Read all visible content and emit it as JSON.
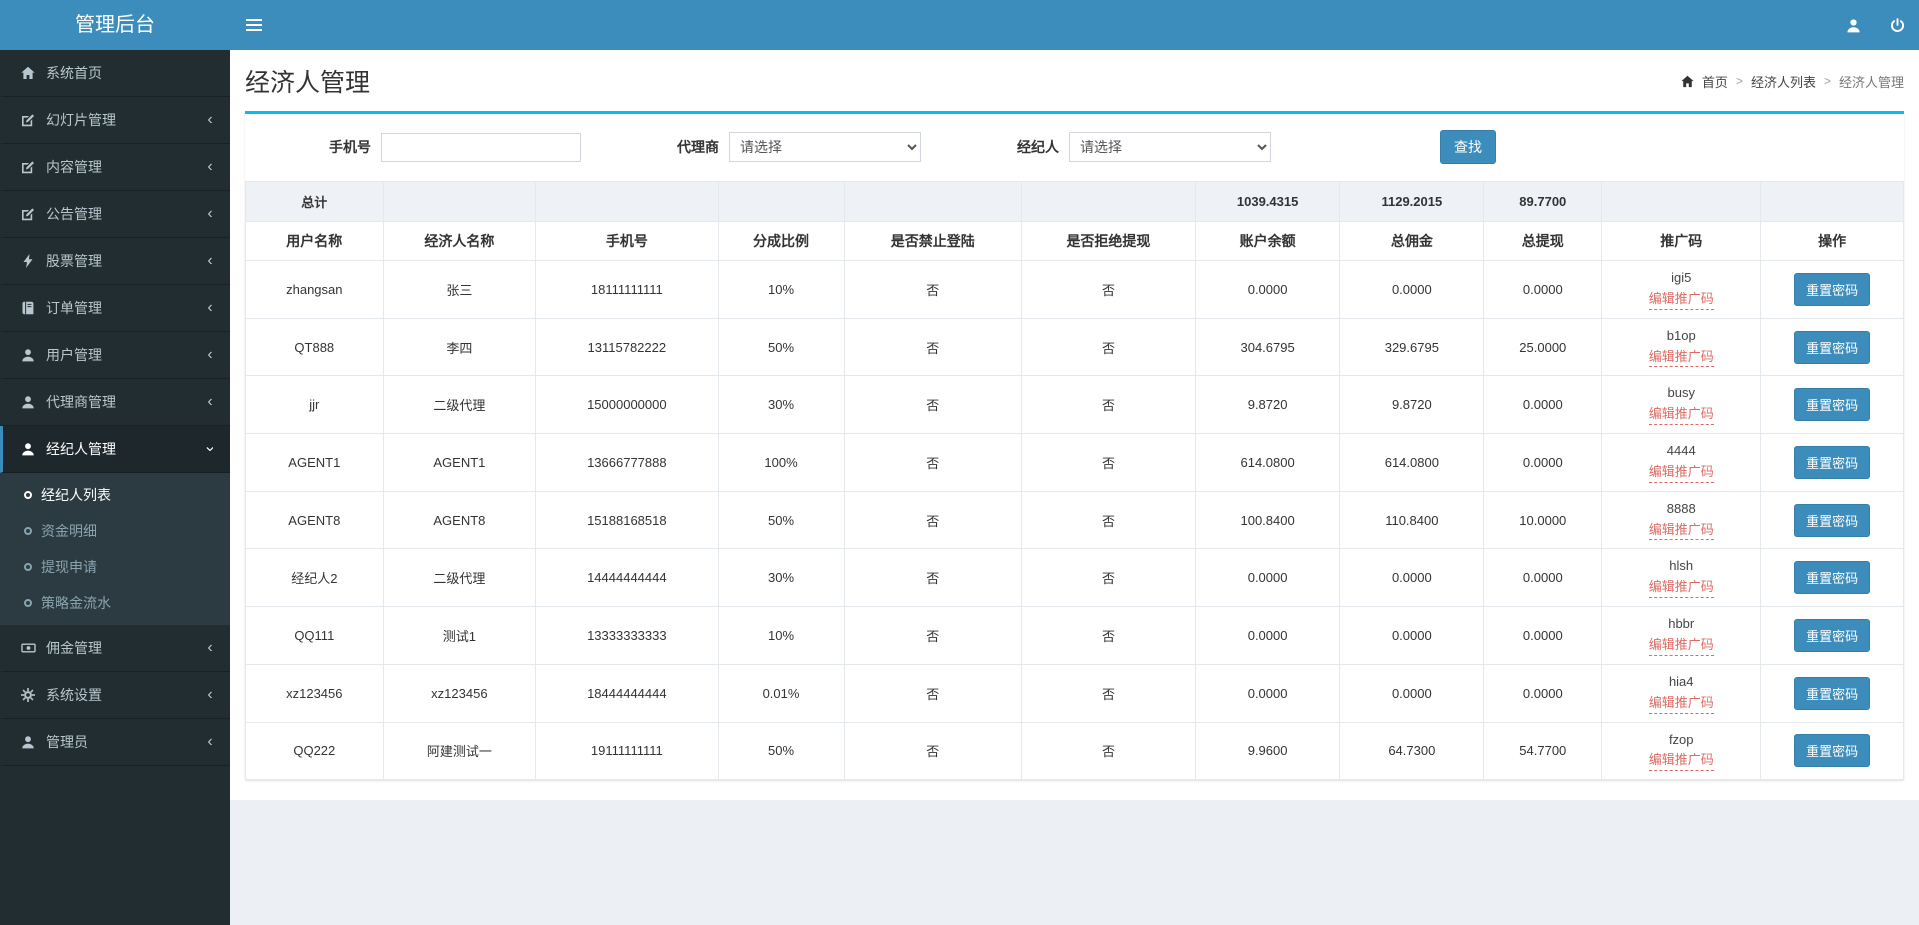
{
  "app": {
    "title": "管理后台"
  },
  "navbar": {
    "icons": [
      "bars-icon",
      "user-icon",
      "power-icon"
    ]
  },
  "sidebar": {
    "items": [
      {
        "label": "系统首页",
        "icon": "home-icon"
      },
      {
        "label": "幻灯片管理",
        "icon": "edit-icon",
        "chevron": "‹"
      },
      {
        "label": "内容管理",
        "icon": "edit-icon",
        "chevron": "‹"
      },
      {
        "label": "公告管理",
        "icon": "edit-icon",
        "chevron": "‹"
      },
      {
        "label": "股票管理",
        "icon": "bolt-icon",
        "chevron": "‹"
      },
      {
        "label": "订单管理",
        "icon": "book-icon",
        "chevron": "‹"
      },
      {
        "label": "用户管理",
        "icon": "user-icon",
        "chevron": "‹"
      },
      {
        "label": "代理商管理",
        "icon": "user-icon",
        "chevron": "‹"
      },
      {
        "label": "经纪人管理",
        "icon": "user-icon",
        "chevron": "‹",
        "active": true,
        "expanded": true,
        "submenu": [
          {
            "label": "经纪人列表",
            "icon": "circle-o-icon",
            "active": true
          },
          {
            "label": "资金明细",
            "icon": "circle-o-icon"
          },
          {
            "label": "提现申请",
            "icon": "circle-o-icon"
          },
          {
            "label": "策略金流水",
            "icon": "circle-o-icon"
          }
        ]
      },
      {
        "label": "佣金管理",
        "icon": "money-icon",
        "chevron": "‹"
      },
      {
        "label": "系统设置",
        "icon": "gear-icon",
        "chevron": "‹"
      },
      {
        "label": "管理员",
        "icon": "user-icon",
        "chevron": "‹"
      }
    ]
  },
  "page": {
    "title": "经济人管理",
    "breadcrumb": [
      "首页",
      "经济人列表",
      "经济人管理"
    ]
  },
  "filters": {
    "phone_label": "手机号",
    "phone_value": "",
    "agent_label": "代理商",
    "agent_selected": "请选择",
    "broker_label": "经纪人",
    "broker_selected": "请选择",
    "search_button": "查找"
  },
  "table": {
    "totals_label": "总计",
    "totals": {
      "balance": "1039.4315",
      "commission": "1129.2015",
      "withdraw": "89.7700"
    },
    "columns": [
      "用户名称",
      "经济人名称",
      "手机号",
      "分成比例",
      "是否禁止登陆",
      "是否拒绝提现",
      "账户余额",
      "总佣金",
      "总提现",
      "推广码",
      "操作"
    ],
    "edit_promo_label": "编辑推广码",
    "reset_password_label": "重置密码",
    "rows": [
      {
        "username": "zhangsan",
        "broker_name": "张三",
        "phone": "18111111111",
        "ratio": "10%",
        "login_forbidden": "否",
        "withdraw_refused": "否",
        "balance": "0.0000",
        "total_commission": "0.0000",
        "total_withdraw": "0.0000",
        "promo_code": "igi5"
      },
      {
        "username": "QT888",
        "broker_name": "李四",
        "phone": "13115782222",
        "ratio": "50%",
        "login_forbidden": "否",
        "withdraw_refused": "否",
        "balance": "304.6795",
        "total_commission": "329.6795",
        "total_withdraw": "25.0000",
        "promo_code": "b1op"
      },
      {
        "username": "jjr",
        "broker_name": "二级代理",
        "phone": "15000000000",
        "ratio": "30%",
        "login_forbidden": "否",
        "withdraw_refused": "否",
        "balance": "9.8720",
        "total_commission": "9.8720",
        "total_withdraw": "0.0000",
        "promo_code": "busy"
      },
      {
        "username": "AGENT1",
        "broker_name": "AGENT1",
        "phone": "13666777888",
        "ratio": "100%",
        "login_forbidden": "否",
        "withdraw_refused": "否",
        "balance": "614.0800",
        "total_commission": "614.0800",
        "total_withdraw": "0.0000",
        "promo_code": "4444"
      },
      {
        "username": "AGENT8",
        "broker_name": "AGENT8",
        "phone": "15188168518",
        "ratio": "50%",
        "login_forbidden": "否",
        "withdraw_refused": "否",
        "balance": "100.8400",
        "total_commission": "110.8400",
        "total_withdraw": "10.0000",
        "promo_code": "8888"
      },
      {
        "username": "经纪人2",
        "broker_name": "二级代理",
        "phone": "14444444444",
        "ratio": "30%",
        "login_forbidden": "否",
        "withdraw_refused": "否",
        "balance": "0.0000",
        "total_commission": "0.0000",
        "total_withdraw": "0.0000",
        "promo_code": "hlsh"
      },
      {
        "username": "QQ111",
        "broker_name": "测试1",
        "phone": "13333333333",
        "ratio": "10%",
        "login_forbidden": "否",
        "withdraw_refused": "否",
        "balance": "0.0000",
        "total_commission": "0.0000",
        "total_withdraw": "0.0000",
        "promo_code": "hbbr"
      },
      {
        "username": "xz123456",
        "broker_name": "xz123456",
        "phone": "18444444444",
        "ratio": "0.01%",
        "login_forbidden": "否",
        "withdraw_refused": "否",
        "balance": "0.0000",
        "total_commission": "0.0000",
        "total_withdraw": "0.0000",
        "promo_code": "hia4"
      },
      {
        "username": "QQ222",
        "broker_name": "阿建测试一",
        "phone": "19111111111",
        "ratio": "50%",
        "login_forbidden": "否",
        "withdraw_refused": "否",
        "balance": "9.9600",
        "total_commission": "64.7300",
        "total_withdraw": "54.7700",
        "promo_code": "fzop"
      }
    ]
  },
  "colors": {
    "navbar": "#3c8dbc",
    "sidebar": "#222d32",
    "box_top_border": "#00c0ef",
    "primary_button": "#3c8dbc",
    "promo_link_red": "#dd6b64"
  }
}
